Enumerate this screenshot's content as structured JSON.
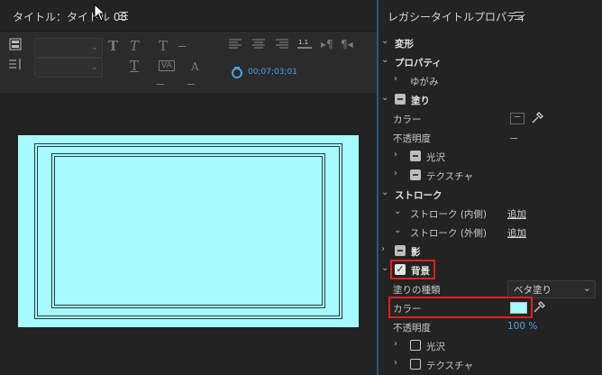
{
  "left_panel": {
    "title": "タイトル：タイトル 08",
    "timecode": "00;07;03;01"
  },
  "right_panel": {
    "title": "レガシータイトルプロパティ",
    "rows": {
      "transform": "変形",
      "properties": "プロパティ",
      "distort": "ゆがみ",
      "fill": "塗り",
      "fill_color": "カラー",
      "fill_color_value": "－",
      "fill_opacity": "不透明度",
      "fill_opacity_value": "－",
      "sheen": "光沢",
      "texture": "テクスチャ",
      "strokes": "ストローク",
      "inner_stroke": "ストローク (内側)",
      "inner_stroke_value": "追加",
      "outer_stroke": "ストローク (外側)",
      "outer_stroke_value": "追加",
      "shadow": "影",
      "background": "背景",
      "fill_type": "塗りの種類",
      "fill_type_value": "ベタ塗り",
      "bg_color": "カラー",
      "bg_opacity": "不透明度",
      "bg_opacity_value": "100 %",
      "bg_sheen": "光沢",
      "bg_texture": "テクスチャ"
    }
  },
  "colors": {
    "canvas_bg": "#a5fbff",
    "background_swatch": "#a5fbff",
    "accent_blue": "#4aa3e8",
    "highlight_red": "#e02020"
  }
}
